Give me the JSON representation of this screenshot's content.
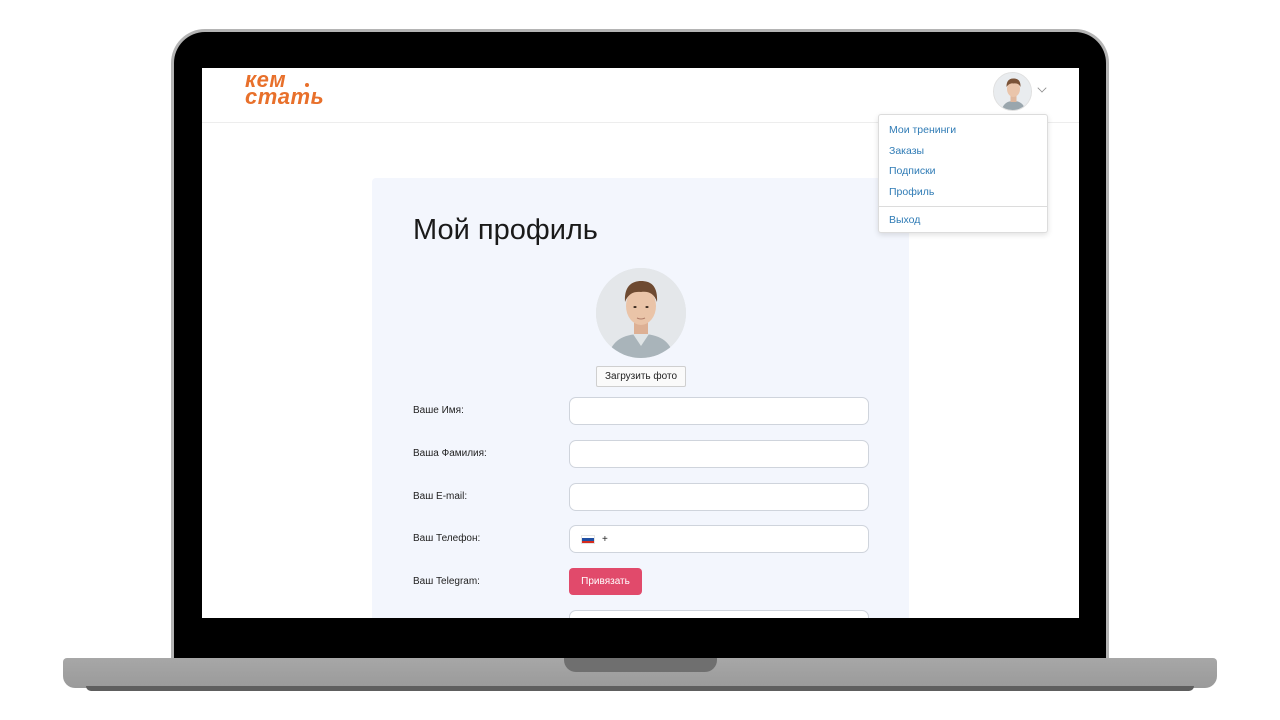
{
  "header": {
    "logo_line1": "кем",
    "logo_line2": "стать"
  },
  "user_menu": {
    "items": [
      {
        "label": "Мои тренинги"
      },
      {
        "label": "Заказы"
      },
      {
        "label": "Подписки"
      },
      {
        "label": "Профиль"
      }
    ],
    "logout_label": "Выход"
  },
  "profile": {
    "title": "Мой профиль",
    "upload_photo_label": "Загрузить фото",
    "fields": {
      "first_name_label": "Ваше Имя:",
      "first_name_value": "",
      "last_name_label": "Ваша Фамилия:",
      "last_name_value": "",
      "email_label": "Ваш E-mail:",
      "email_value": "",
      "phone_label": "Ваш Телефон:",
      "phone_prefix": "+",
      "telegram_label": "Ваш Telegram:",
      "telegram_button": "Привязать"
    }
  },
  "colors": {
    "brand_orange": "#e8702b",
    "link_blue": "#2f7bb5",
    "telegram_button": "#e14a6b",
    "card_background": "#f3f6fd"
  },
  "icons": {
    "avatar": "user-avatar-photo",
    "menu_toggle": "chevron-down-icon",
    "phone_country": "russia-flag-icon"
  }
}
